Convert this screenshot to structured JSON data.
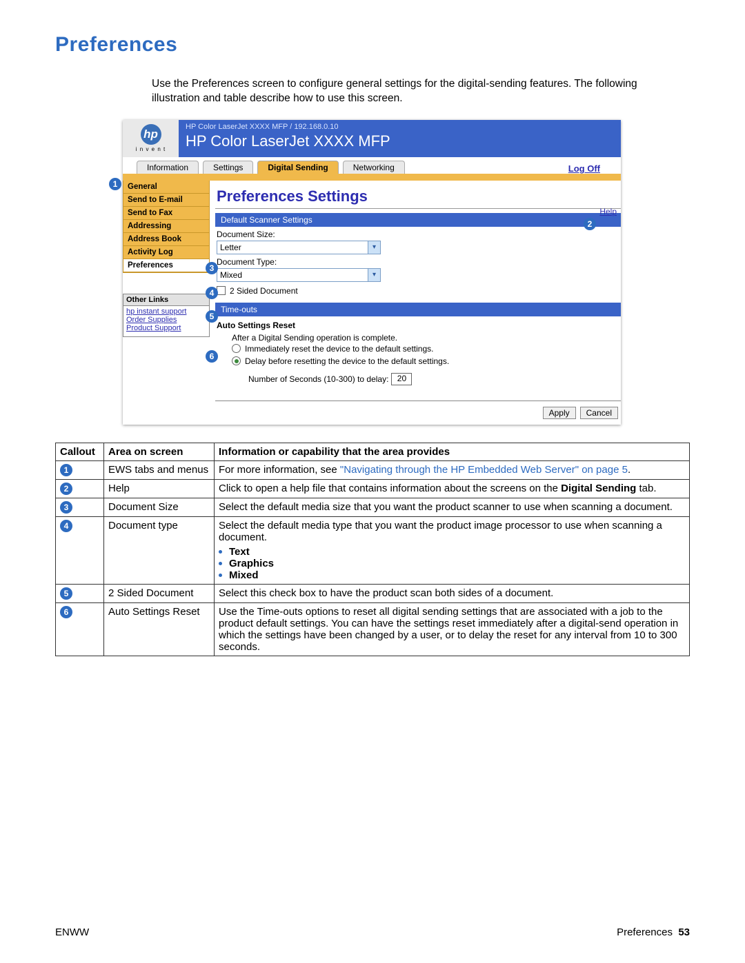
{
  "page_title": "Preferences",
  "intro": "Use the Preferences screen to configure general settings for the digital-sending features. The following illustration and table describe how to use this screen.",
  "illus": {
    "logo_sub": "i n v e n t",
    "hdr_path": "HP Color LaserJet XXXX MFP / 192.168.0.10",
    "hdr_title": "HP Color LaserJet XXXX MFP",
    "tabs": {
      "t1": "Information",
      "t2": "Settings",
      "t3": "Digital Sending",
      "t4": "Networking"
    },
    "logoff": "Log Off",
    "menu": {
      "m1": "General",
      "m2": "Send to E-mail",
      "m3": "Send to Fax",
      "m4": "Addressing",
      "m5": "Address Book",
      "m6": "Activity Log",
      "m7": "Preferences"
    },
    "links_title": "Other Links",
    "links": {
      "l1": "hp instant support",
      "l2": "Order Supplies",
      "l3": "Product Support"
    },
    "prefs_title": "Preferences Settings",
    "help": "Help",
    "sec1": "Default Scanner Settings",
    "doc_size_label": "Document Size:",
    "doc_size_value": "Letter",
    "doc_type_label": "Document Type:",
    "doc_type_value": "Mixed",
    "two_sided": "2 Sided Document",
    "sec2": "Time-outs",
    "auto_title": "Auto Settings Reset",
    "auto_line": "After a Digital Sending operation is complete.",
    "radio_immediate": "Immediately reset the device to the default settings.",
    "radio_delay": "Delay before resetting the device to the default settings.",
    "delay_label": "Number of Seconds (10-300) to delay:",
    "delay_value": "20",
    "apply": "Apply",
    "cancel": "Cancel"
  },
  "table": {
    "h1": "Callout",
    "h2": "Area on screen",
    "h3": "Information or capability that the area provides",
    "r1_area": "EWS tabs and menus",
    "r1_info_a": "For more information, see ",
    "r1_info_link": "\"Navigating through the HP Embedded Web Server\" on page 5",
    "r1_info_b": ".",
    "r2_area": "Help",
    "r2_info_a": "Click to open a help file that contains information about the screens on the ",
    "r2_info_bold": "Digital Sending",
    "r2_info_b": " tab.",
    "r3_area": "Document Size",
    "r3_info": "Select the default media size that you want the product scanner to use when scanning a document.",
    "r4_area": "Document type",
    "r4_info": "Select the default media type that you want the product image processor to use when scanning a document.",
    "r4_b1": "Text",
    "r4_b2": "Graphics",
    "r4_b3": "Mixed",
    "r5_area": "2 Sided Document",
    "r5_info": "Select this check box to have the product scan both sides of a document.",
    "r6_area": "Auto Settings Reset",
    "r6_info": "Use the Time-outs options to reset all digital sending settings that are associated with a job to the product default settings. You can have the settings reset immediately after a digital-send operation in which the settings have been changed by a user, or to delay the reset for any interval from 10 to 300 seconds."
  },
  "footer": {
    "left": "ENWW",
    "right_label": "Preferences",
    "right_page": "53"
  }
}
